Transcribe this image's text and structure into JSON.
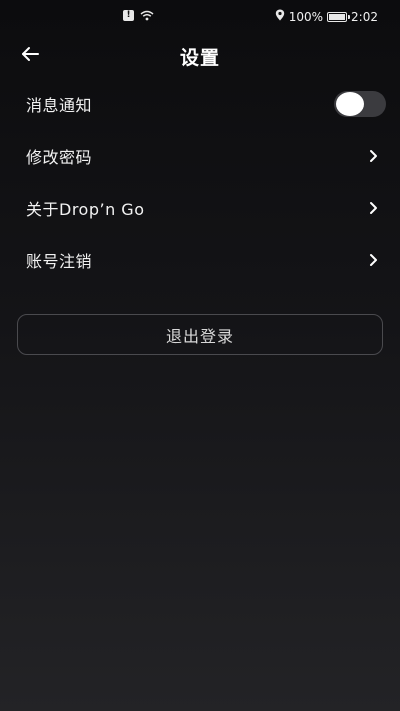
{
  "status_bar": {
    "battery_percent": "100%",
    "time": "2:02",
    "icons": [
      "alert-icon",
      "wifi-icon",
      "location-icon",
      "battery-icon"
    ]
  },
  "header": {
    "title": "设置",
    "back_icon": "arrow-left-icon"
  },
  "settings": {
    "items": [
      {
        "label": "消息通知",
        "control": "toggle",
        "toggle_on": false
      },
      {
        "label": "修改密码",
        "control": "chevron"
      },
      {
        "label": "关于Drop’n Go",
        "control": "chevron"
      },
      {
        "label": "账号注销",
        "control": "chevron"
      }
    ]
  },
  "logout": {
    "label": "退出登录"
  },
  "colors": {
    "background_top": "#0c0c0e",
    "background_bottom": "#232326",
    "text": "#f2f2f2",
    "toggle_track": "#3b3b3f",
    "button_border": "#4a4a4e"
  }
}
